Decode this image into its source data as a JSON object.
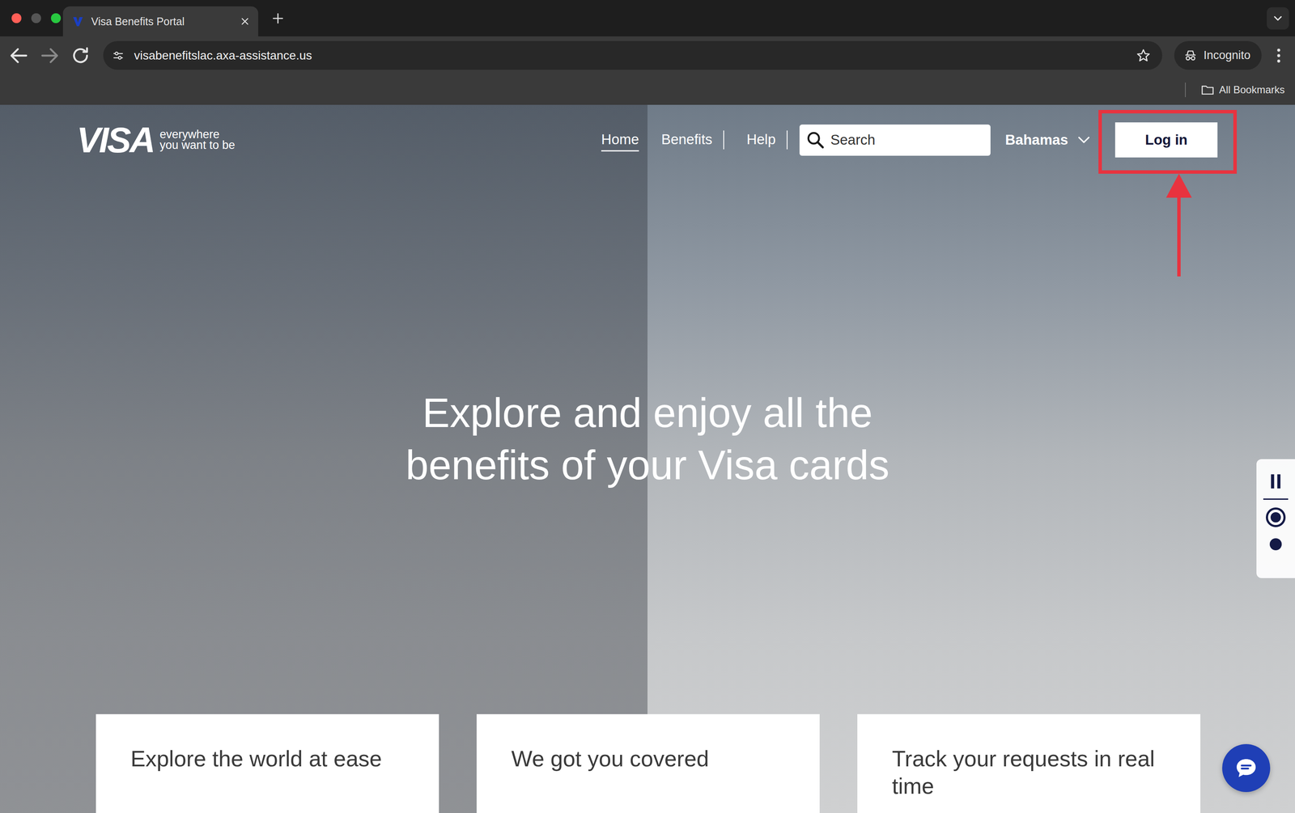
{
  "browser": {
    "tabs": [
      {
        "label": "Visa Benefits Portal",
        "selected": true
      }
    ],
    "address": "visabenefitslac.axa-assistance.us",
    "profile": "Incognito",
    "bookmarks": {
      "folder": "All Bookmarks"
    }
  },
  "page": {
    "logo": {
      "wordmark": "VISA",
      "tagline": [
        "everywhere",
        "you want to be"
      ]
    },
    "nav": [
      {
        "label": "Home",
        "selected": true
      },
      {
        "label": "Benefits",
        "selected": false
      },
      {
        "label": "Help",
        "selected": false
      }
    ],
    "search": {
      "placeholder": "Search"
    },
    "country": "Bahamas",
    "login": {
      "label": "Log in",
      "highlighted": true
    },
    "headline": [
      "Explore and enjoy all the",
      "benefits of your Visa cards"
    ],
    "carousel": {
      "playing": true,
      "slides": [
        {
          "selected": true
        },
        {
          "selected": false
        }
      ]
    },
    "cards": [
      {
        "title": "Explore the world at ease"
      },
      {
        "title": "We got you covered"
      },
      {
        "title": "Track your requests in real time"
      }
    ]
  }
}
